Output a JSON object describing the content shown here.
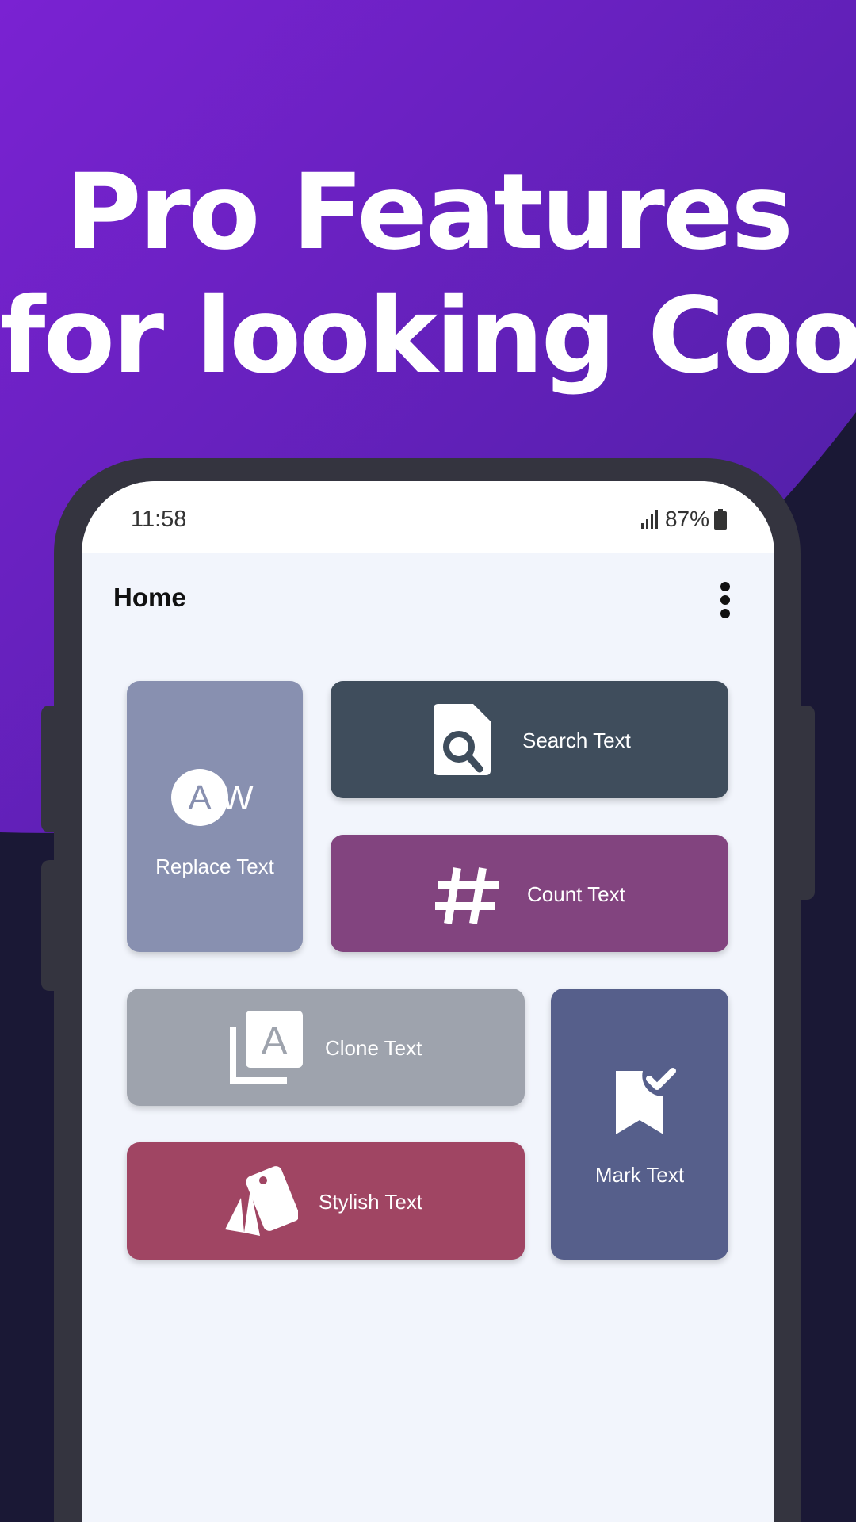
{
  "headline": {
    "line1": "Pro Features",
    "line2": "for looking Cool"
  },
  "status_bar": {
    "time": "11:58",
    "battery": "87%"
  },
  "app_bar": {
    "title": "Home"
  },
  "cards": {
    "replace": {
      "label": "Replace Text",
      "color": "#8890b0"
    },
    "search": {
      "label": "Search Text",
      "color": "#3f4d5c"
    },
    "count": {
      "label": "Count Text",
      "color": "#82447f"
    },
    "clone": {
      "label": "Clone Text",
      "color": "#9ea3ad"
    },
    "stylish": {
      "label": "Stylish Text",
      "color": "#a04563"
    },
    "mark": {
      "label": "Mark Text",
      "color": "#565f8b"
    }
  },
  "icons": {
    "replace": "replace-text-icon",
    "search": "search-document-icon",
    "count": "hash-icon",
    "clone": "clone-layers-icon",
    "stylish": "color-swatch-icon",
    "mark": "bookmark-check-icon"
  },
  "colors": {
    "background_top": "#6a1fc4",
    "background_bottom": "#1a1835",
    "phone_frame": "#34343f",
    "screen_bg": "#f2f5fc"
  }
}
